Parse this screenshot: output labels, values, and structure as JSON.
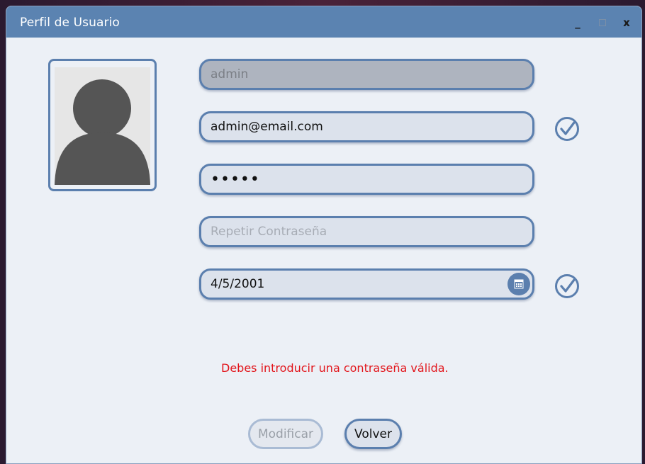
{
  "window": {
    "title": "Perfil de Usuario",
    "controls": {
      "minimize": "_",
      "close": "x"
    }
  },
  "form": {
    "username": {
      "value": "admin",
      "disabled": true
    },
    "email": {
      "value": "admin@email.com",
      "valid": true
    },
    "password": {
      "value": "•••••"
    },
    "repeat_password": {
      "placeholder": "Repetir Contraseña",
      "value": ""
    },
    "birthdate": {
      "value": "4/5/2001",
      "valid": true
    }
  },
  "error_message": "Debes introducir una contraseña válida.",
  "buttons": {
    "modify": {
      "label": "Modificar",
      "enabled": false
    },
    "back": {
      "label": "Volver",
      "enabled": true
    }
  },
  "colors": {
    "titlebar": "#5b83b1",
    "accent": "#5b7fae",
    "error": "#e2151b",
    "background": "#ecf0f6"
  },
  "icons": [
    "user-avatar-icon",
    "check-circle-icon",
    "calendar-icon"
  ]
}
